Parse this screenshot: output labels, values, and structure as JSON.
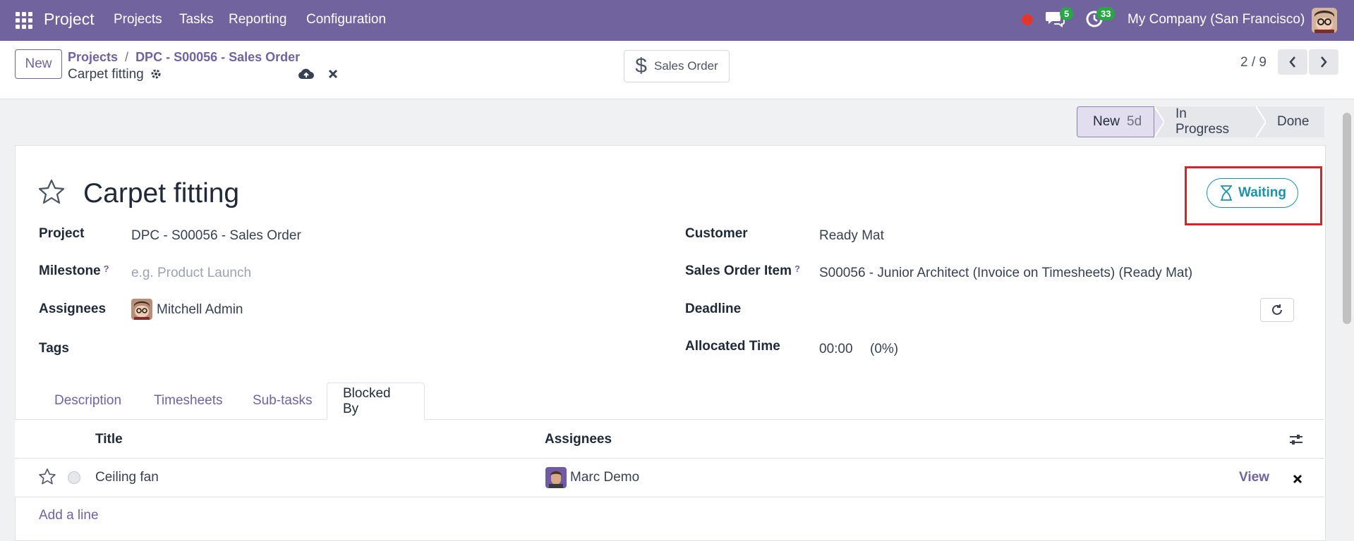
{
  "navbar": {
    "app_name": "Project",
    "menu": [
      "Projects",
      "Tasks",
      "Reporting",
      "Configuration"
    ],
    "messages_count": "5",
    "activities_count": "33",
    "company": "My Company (San Francisco)"
  },
  "control_panel": {
    "new_label": "New",
    "breadcrumb_parent": "Projects",
    "breadcrumb_sep": "/",
    "breadcrumb_project": "DPC - S00056 - Sales Order",
    "breadcrumb_current": "Carpet fitting",
    "smart_button_label": "Sales Order",
    "pager": "2 / 9"
  },
  "statusbar": {
    "stages": [
      {
        "label": "New",
        "duration": "5d",
        "active": true
      },
      {
        "label": "In Progress"
      },
      {
        "label": "Done"
      }
    ]
  },
  "form": {
    "title": "Carpet fitting",
    "state_label": "Waiting",
    "fields": {
      "project_label": "Project",
      "project_value": "DPC - S00056 - Sales Order",
      "milestone_label": "Milestone",
      "milestone_placeholder": "e.g. Product Launch",
      "assignees_label": "Assignees",
      "assignees_value": "Mitchell Admin",
      "tags_label": "Tags",
      "customer_label": "Customer",
      "customer_value": "Ready Mat",
      "so_item_label": "Sales Order Item",
      "so_item_value": "S00056 - Junior Architect (Invoice on Timesheets) (Ready Mat)",
      "deadline_label": "Deadline",
      "allocated_label": "Allocated Time",
      "allocated_value": "00:00",
      "allocated_pct": "(0%)",
      "help_mark": "?"
    }
  },
  "tabs": [
    "Description",
    "Timesheets",
    "Sub-tasks",
    "Blocked By"
  ],
  "active_tab": "Blocked By",
  "blocked_list": {
    "columns": [
      "Title",
      "Assignees"
    ],
    "rows": [
      {
        "title": "Ceiling fan",
        "assignee": "Marc Demo",
        "action": "View"
      }
    ],
    "add_line": "Add a line"
  },
  "colors": {
    "brand": "#71639e",
    "waiting": "#1b93a8",
    "highlight": "#d9222a"
  }
}
